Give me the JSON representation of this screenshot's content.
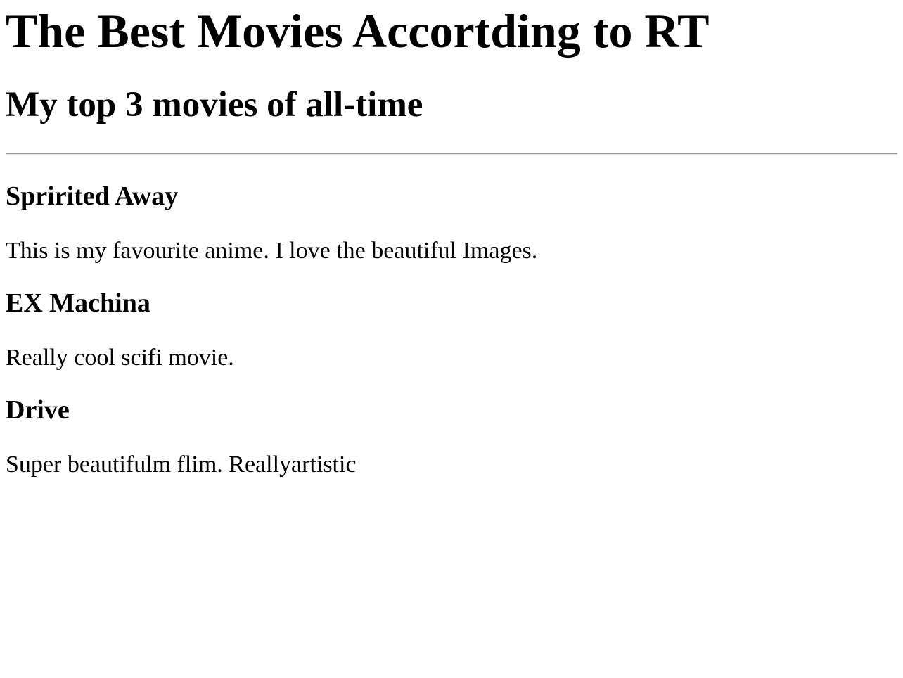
{
  "page": {
    "title": "The Best Movies Accortding to RT",
    "subtitle": "My top 3 movies of all-time"
  },
  "movies": [
    {
      "name": "Spririted Away",
      "description": "This is my favourite anime. I love the beautiful Images."
    },
    {
      "name": "EX Machina",
      "description": "Really cool scifi movie."
    },
    {
      "name": "Drive",
      "description": "Super beautifulm flim. Reallyartistic"
    }
  ]
}
